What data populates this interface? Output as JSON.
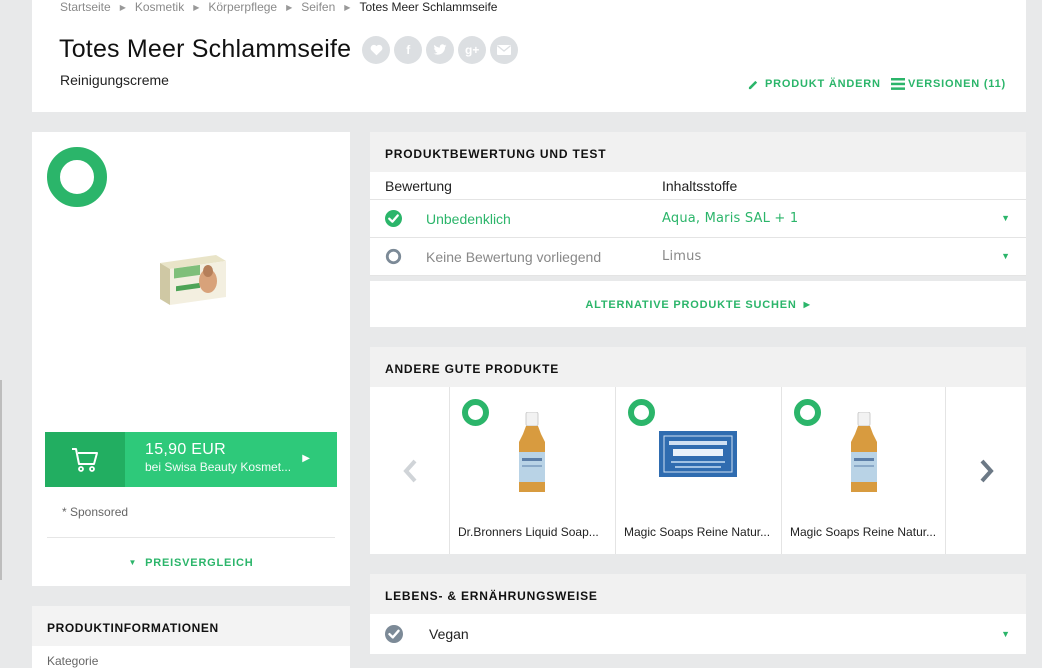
{
  "breadcrumb": [
    "Startseite",
    "Kosmetik",
    "Körperpflege",
    "Seifen",
    "Totes Meer Schlammseife"
  ],
  "product": {
    "title": "Totes Meer Schlammseife",
    "subtitle": "Reinigungscreme"
  },
  "share_icons": [
    "heart-icon",
    "facebook-icon",
    "twitter-icon",
    "google-plus-icon",
    "email-icon"
  ],
  "actions": {
    "edit": "PRODUKT ÄNDERN",
    "versions": "VERSIONEN (11)"
  },
  "buy": {
    "price": "15,90 EUR",
    "seller": "bei Swisa Beauty Kosmet...",
    "sponsored": "* Sponsored",
    "compare": "PREISVERGLEICH"
  },
  "product_info": {
    "heading": "PRODUKTINFORMATIONEN",
    "first_label": "Kategorie"
  },
  "review": {
    "heading": "PRODUKTBEWERTUNG UND TEST",
    "col_rating": "Bewertung",
    "col_ingredients": "Inhaltsstoffe",
    "rows": [
      {
        "rating": "Unbedenklich",
        "ingredients": "Aqua, Maris SAL + 1",
        "status": "good"
      },
      {
        "rating": "Keine Bewertung vorliegend",
        "ingredients": "Limus",
        "status": "none"
      }
    ],
    "alternatives": "ALTERNATIVE PRODUKTE SUCHEN"
  },
  "other_products": {
    "heading": "ANDERE GUTE PRODUKTE",
    "items": [
      {
        "name": "Dr.Bronners Liquid Soap..."
      },
      {
        "name": "Magic Soaps Reine Natur..."
      },
      {
        "name": "Magic Soaps Reine Natur..."
      }
    ]
  },
  "lifestyle": {
    "heading": "LEBENS- & ERNÄHRUNGSWEISE",
    "rows": [
      {
        "label": "Vegan"
      }
    ]
  },
  "colors": {
    "accent": "#2bb56a",
    "buy_box": "#2ec97a",
    "buy_cart": "#22ae61",
    "page_bg": "#e8e9ea"
  }
}
